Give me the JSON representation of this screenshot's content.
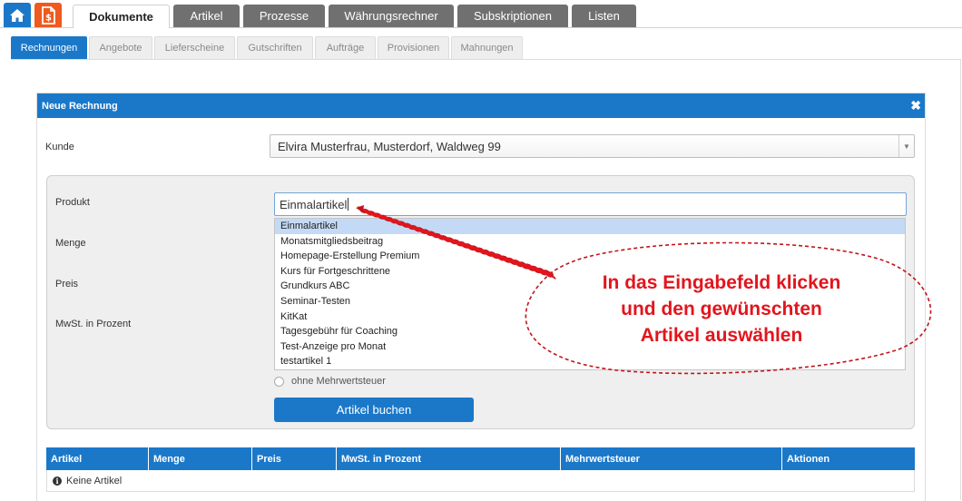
{
  "main_tabs": [
    {
      "label": "Dokumente",
      "active": true
    },
    {
      "label": "Artikel",
      "active": false
    },
    {
      "label": "Prozesse",
      "active": false
    },
    {
      "label": "Währungsrechner",
      "active": false
    },
    {
      "label": "Subskriptionen",
      "active": false
    },
    {
      "label": "Listen",
      "active": false
    }
  ],
  "sub_tabs": [
    {
      "label": "Rechnungen",
      "active": true
    },
    {
      "label": "Angebote",
      "active": false
    },
    {
      "label": "Lieferscheine",
      "active": false
    },
    {
      "label": "Gutschriften",
      "active": false
    },
    {
      "label": "Aufträge",
      "active": false
    },
    {
      "label": "Provisionen",
      "active": false
    },
    {
      "label": "Mahnungen",
      "active": false
    }
  ],
  "dialog": {
    "title": "Neue Rechnung",
    "kunde_label": "Kunde",
    "kunde_value": "Elvira Musterfrau, Musterdorf, Waldweg 99",
    "produkt_label": "Produkt",
    "produkt_value": "Einmalartikel",
    "menge_label": "Menge",
    "preis_label": "Preis",
    "mwst_label": "MwSt. in Prozent",
    "product_options": [
      "Einmalartikel",
      "Monatsmitgliedsbeitrag",
      "Homepage-Erstellung Premium",
      "Kurs für Fortgeschrittene",
      "Grundkurs ABC",
      "Seminar-Testen",
      "KitKat",
      "Tagesgebühr für Coaching",
      "Test-Anzeige pro Monat",
      "testartikel 1"
    ],
    "radio_label": "ohne Mehrwertsteuer",
    "book_button": "Artikel buchen"
  },
  "table": {
    "columns": [
      "Artikel",
      "Menge",
      "Preis",
      "MwSt. in Prozent",
      "Mehrwertsteuer",
      "Aktionen"
    ],
    "empty_text": "Keine Artikel"
  },
  "annotation": {
    "line1": "In das Eingabefeld klicken",
    "line2": "und den gewünschten",
    "line3": "Artikel auswählen"
  },
  "colors": {
    "primary": "#1b78c9",
    "inactive_tab": "#707070",
    "orange_icon": "#ef5a1f",
    "annotation": "#e2151d"
  }
}
